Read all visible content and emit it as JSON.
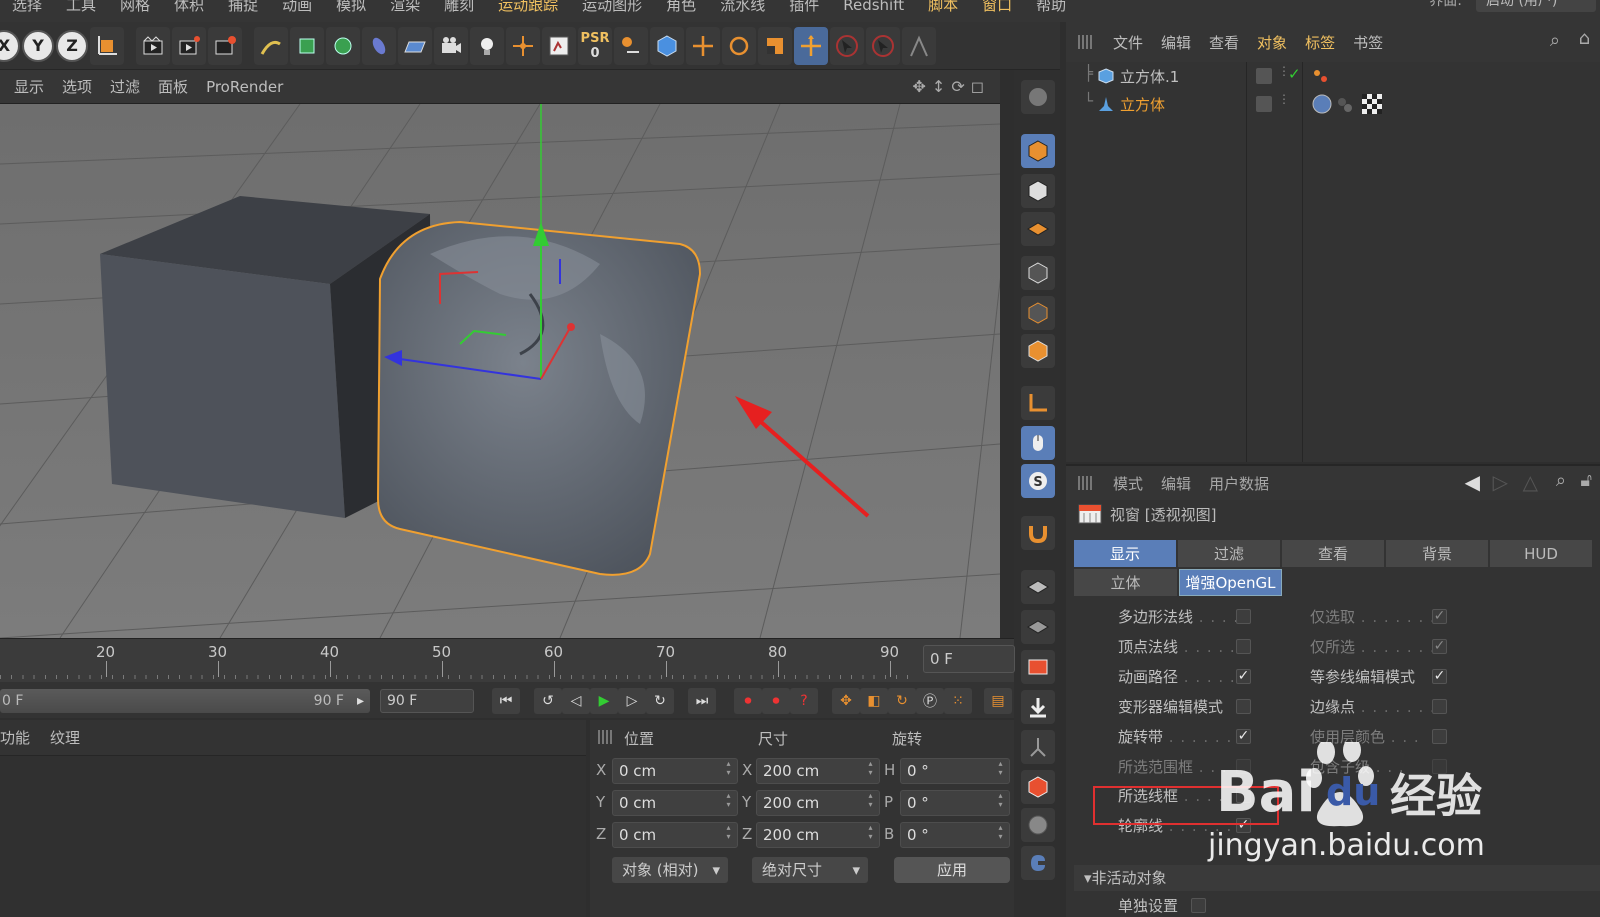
{
  "menubar": {
    "items": [
      "选择",
      "工具",
      "网格",
      "体积",
      "捕捉",
      "动画",
      "模拟",
      "渲染",
      "雕刻",
      "运动跟踪",
      "运动图形",
      "角色",
      "流水线",
      "插件",
      "Redshift",
      "脚本",
      "窗口",
      "帮助"
    ],
    "layout_label": "界面:",
    "layout_value": "启动 (用户)"
  },
  "toolbar": {
    "axis": [
      "X",
      "Y",
      "Z"
    ],
    "psr_label": "PSR",
    "psr_value": "0"
  },
  "viewport_menu": [
    "显示",
    "选项",
    "过滤",
    "面板",
    "ProRender"
  ],
  "object_manager": {
    "menu": [
      "文件",
      "编辑",
      "查看",
      "对象",
      "标签",
      "书签"
    ],
    "objects": [
      {
        "name": "立方体.1",
        "selected": false
      },
      {
        "name": "立方体",
        "selected": true
      }
    ]
  },
  "attribute_manager": {
    "menu": [
      "模式",
      "编辑",
      "用户数据"
    ],
    "title": "视窗 [透视视图]",
    "tabs": [
      "显示",
      "过滤",
      "查看",
      "背景",
      "HUD"
    ],
    "subtabs": [
      "立体",
      "增强OpenGL"
    ],
    "options_left": [
      {
        "label": "多边形法线",
        "checked": false
      },
      {
        "label": "顶点法线",
        "checked": false
      },
      {
        "label": "动画路径",
        "checked": true
      },
      {
        "label": "变形器编辑模式",
        "checked": false
      },
      {
        "label": "旋转带",
        "checked": true
      },
      {
        "label": "所选范围框",
        "checked": false,
        "dim": true
      },
      {
        "label": "所选线框",
        "checked": false
      },
      {
        "label": "轮廓线",
        "checked": true
      }
    ],
    "options_right": [
      {
        "label": "仅选取",
        "checked": true,
        "dim": true
      },
      {
        "label": "仅所选",
        "checked": true,
        "dim": true
      },
      {
        "label": "等参线编辑模式",
        "checked": true
      },
      {
        "label": "边缘点",
        "checked": false
      },
      {
        "label": "使用层颜色",
        "checked": false,
        "dim": true
      },
      {
        "label": "包含子级",
        "checked": false,
        "dim": true
      }
    ],
    "section_inactive": "非活动对象",
    "single_setting": "单独设置"
  },
  "timeline": {
    "ticks": [
      "20",
      "30",
      "40",
      "50",
      "60",
      "70",
      "80",
      "90"
    ],
    "current_frame": "0 F"
  },
  "transport": {
    "range_start": "0 F",
    "range_end_inner": "90 F",
    "range_end": "90 F"
  },
  "material_menu": [
    "功能",
    "纹理"
  ],
  "coordinates": {
    "headers": [
      "位置",
      "尺寸",
      "旋转"
    ],
    "rows": [
      {
        "axis": "X",
        "pos": "0 cm",
        "size_axis": "X",
        "size": "200 cm",
        "rot_axis": "H",
        "rot": "0 °"
      },
      {
        "axis": "Y",
        "pos": "0 cm",
        "size_axis": "Y",
        "size": "200 cm",
        "rot_axis": "P",
        "rot": "0 °"
      },
      {
        "axis": "Z",
        "pos": "0 cm",
        "size_axis": "Z",
        "size": "200 cm",
        "rot_axis": "B",
        "rot": "0 °"
      }
    ],
    "mode": "对象 (相对)",
    "size_mode": "绝对尺寸",
    "apply": "应用"
  },
  "watermark": {
    "brand": "Bai",
    "brand2": "du",
    "cn": "经验",
    "url": "jingyan.baidu.com"
  },
  "colors": {
    "accent_blue": "#5a7eb8",
    "selection_orange": "#f0a030",
    "annotation_red": "#e03030"
  }
}
